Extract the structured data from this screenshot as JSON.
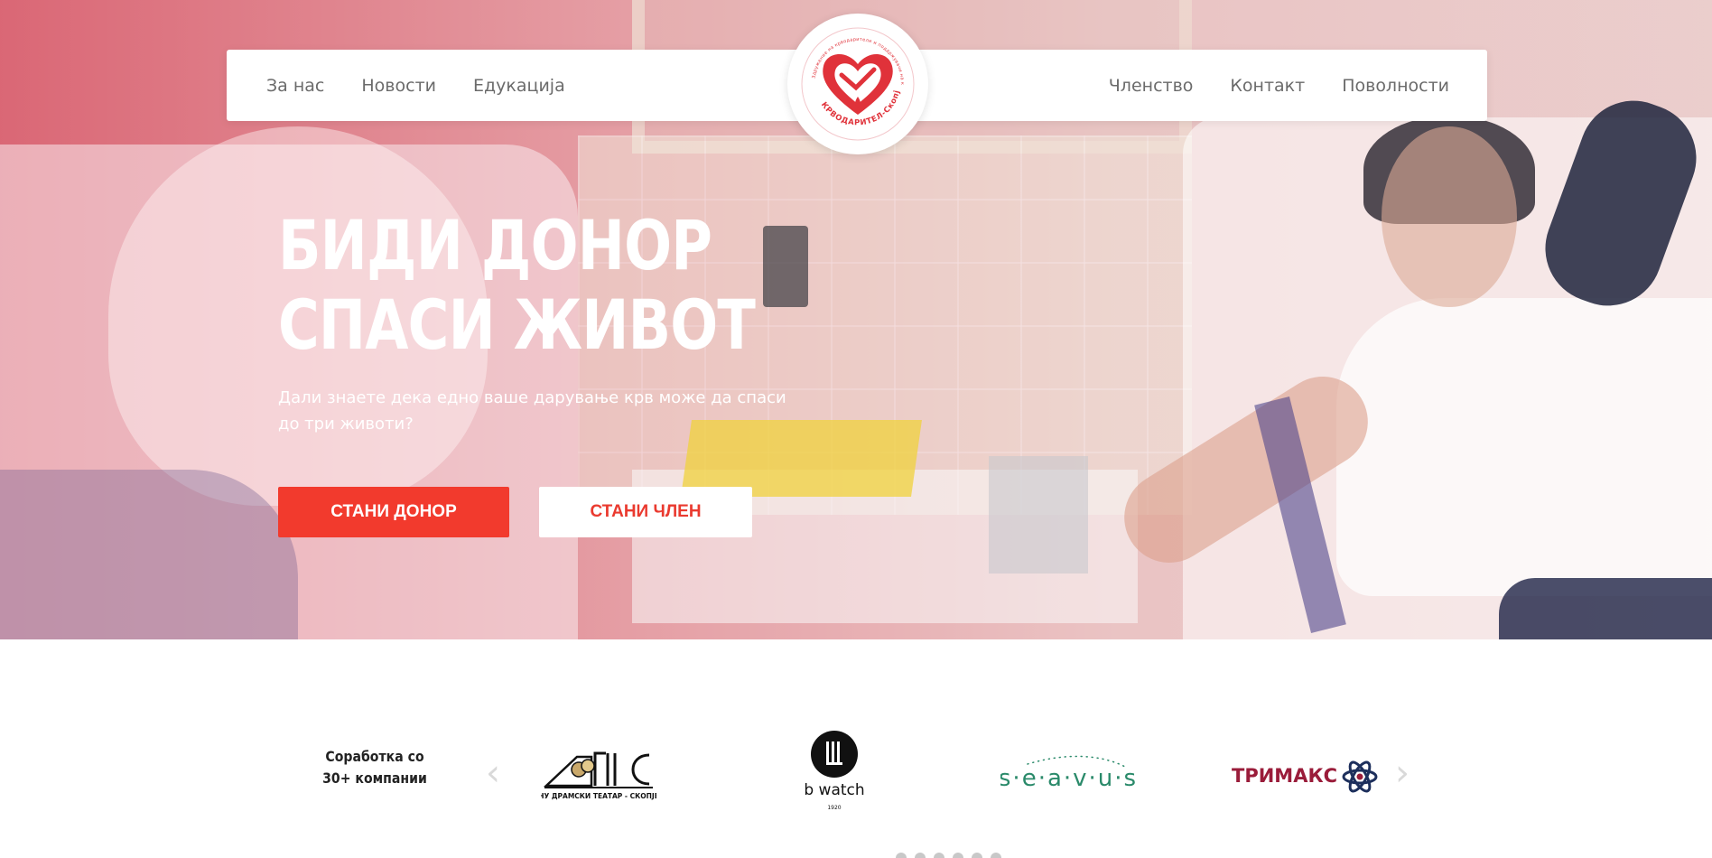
{
  "nav": {
    "left_items": [
      {
        "label": "За нас"
      },
      {
        "label": "Новости"
      },
      {
        "label": "Едукација"
      }
    ],
    "right_items": [
      {
        "label": "Членство"
      },
      {
        "label": "Контакт"
      },
      {
        "label": "Поволности"
      }
    ],
    "logo": {
      "name": "krvodaritel-skopje-logo",
      "text": "КРВОДАРИТЕЛ-Скопје"
    }
  },
  "hero": {
    "title_line1": "БИДИ ДОНОР",
    "title_line2": "СПАСИ ЖИВОТ",
    "subtitle": "Дали знаете дека едно ваше дарување крв може да спаси до три животи?",
    "primary_button": "СТАНИ ДОНОР",
    "secondary_button": "СТАНИ ЧЛЕН"
  },
  "partners": {
    "title": "Соработка со 30+ компании",
    "logos": [
      {
        "name": "drama-theatre-logo",
        "text": "НУ ДРАМСКИ ТЕАТАР - СКОПЈЕ"
      },
      {
        "name": "bwatch-logo",
        "text": "b watch",
        "year": "1920"
      },
      {
        "name": "seavus-logo",
        "text": "s·e·a·v·u·s"
      },
      {
        "name": "trimaks-logo",
        "text": "ТРИМАКС"
      }
    ]
  },
  "colors": {
    "brand_red": "#f23a2d",
    "nav_text": "#6b6b6b",
    "logo_red": "#e0323a",
    "seavus_green": "#2a8a6a",
    "trimaks_maroon": "#9a1c3a",
    "trimaks_navy": "#1d2f5c"
  }
}
